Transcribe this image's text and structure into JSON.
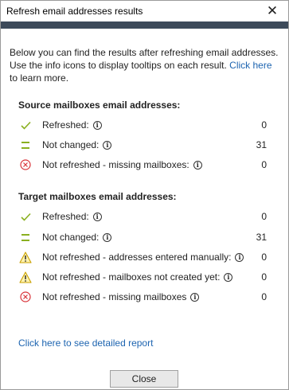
{
  "window": {
    "title": "Refresh email addresses results",
    "close_glyph": "✕"
  },
  "intro": {
    "text": "Below you can find the results after refreshing email addresses. Use the info icons to display tooltips on each result.",
    "link": "Click here",
    "text_after": "to learn more."
  },
  "source": {
    "title": "Source mailboxes email addresses:",
    "rows": [
      {
        "icon": "check-icon",
        "label": "Refreshed:",
        "count": "0"
      },
      {
        "icon": "equals-icon",
        "label": "Not changed:",
        "count": "31"
      },
      {
        "icon": "error-circle-icon",
        "label": "Not refreshed - missing mailboxes:",
        "count": "0"
      }
    ]
  },
  "target": {
    "title": "Target mailboxes email addresses:",
    "rows": [
      {
        "icon": "check-icon",
        "label": "Refreshed:",
        "count": "0"
      },
      {
        "icon": "equals-icon",
        "label": "Not changed:",
        "count": "31"
      },
      {
        "icon": "warning-icon",
        "label": "Not refreshed - addresses entered manually:",
        "count": "0"
      },
      {
        "icon": "warning-icon",
        "label": "Not refreshed - mailboxes not created yet:",
        "count": "0"
      },
      {
        "icon": "error-circle-icon",
        "label": "Not refreshed - missing mailboxes",
        "count": "0"
      }
    ]
  },
  "report_link": "Click here to see detailed report",
  "buttons": {
    "close": "Close"
  },
  "info_glyph": "i",
  "colors": {
    "accent": "#3d4a5a",
    "link": "#1d64b0",
    "check": "#8ab020",
    "warning": "#e6b800",
    "error": "#d9343a"
  }
}
